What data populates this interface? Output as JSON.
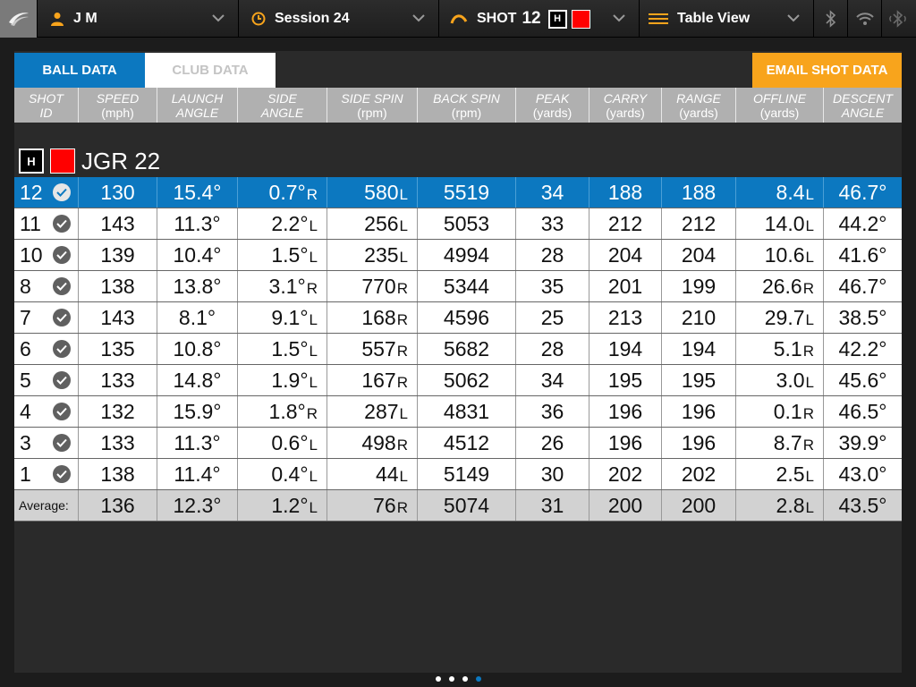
{
  "topbar": {
    "user": "J M",
    "session": "Session 24",
    "shot_label": "SHOT",
    "shot_number": "12",
    "shot_hand": "H",
    "view": "Table View"
  },
  "tabs": [
    {
      "label": "BALL DATA",
      "active": true
    },
    {
      "label": "CLUB DATA",
      "active": false
    }
  ],
  "email_button": "EMAIL SHOT DATA",
  "columns": [
    [
      "SHOT",
      "ID"
    ],
    [
      "SPEED",
      "(mph)"
    ],
    [
      "LAUNCH",
      "ANGLE"
    ],
    [
      "SIDE",
      "ANGLE"
    ],
    [
      "SIDE SPIN",
      "(rpm)"
    ],
    [
      "BACK SPIN",
      "(rpm)"
    ],
    [
      "PEAK",
      "(yards)"
    ],
    [
      "CARRY",
      "(yards)"
    ],
    [
      "RANGE",
      "(yards)"
    ],
    [
      "OFFLINE",
      "(yards)"
    ],
    [
      "DESCENT",
      "ANGLE"
    ]
  ],
  "club": {
    "hand": "H",
    "name": "JGR 22",
    "color": "#ff0000"
  },
  "rows": [
    {
      "id": "12",
      "selected": true,
      "speed": "130",
      "launch": "15.4°",
      "side": "0.7°",
      "side_dir": "R",
      "spin": "580",
      "spin_dir": "L",
      "back": "5519",
      "peak": "34",
      "carry": "188",
      "range": "188",
      "offline": "8.4",
      "off_dir": "L",
      "descent": "46.7°"
    },
    {
      "id": "11",
      "speed": "143",
      "launch": "11.3°",
      "side": "2.2°",
      "side_dir": "L",
      "spin": "256",
      "spin_dir": "L",
      "back": "5053",
      "peak": "33",
      "carry": "212",
      "range": "212",
      "offline": "14.0",
      "off_dir": "L",
      "descent": "44.2°"
    },
    {
      "id": "10",
      "speed": "139",
      "launch": "10.4°",
      "side": "1.5°",
      "side_dir": "L",
      "spin": "235",
      "spin_dir": "L",
      "back": "4994",
      "peak": "28",
      "carry": "204",
      "range": "204",
      "offline": "10.6",
      "off_dir": "L",
      "descent": "41.6°"
    },
    {
      "id": "8",
      "speed": "138",
      "launch": "13.8°",
      "side": "3.1°",
      "side_dir": "R",
      "spin": "770",
      "spin_dir": "R",
      "back": "5344",
      "peak": "35",
      "carry": "201",
      "range": "199",
      "offline": "26.6",
      "off_dir": "R",
      "descent": "46.7°"
    },
    {
      "id": "7",
      "speed": "143",
      "launch": "8.1°",
      "side": "9.1°",
      "side_dir": "L",
      "spin": "168",
      "spin_dir": "R",
      "back": "4596",
      "peak": "25",
      "carry": "213",
      "range": "210",
      "offline": "29.7",
      "off_dir": "L",
      "descent": "38.5°"
    },
    {
      "id": "6",
      "speed": "135",
      "launch": "10.8°",
      "side": "1.5°",
      "side_dir": "L",
      "spin": "557",
      "spin_dir": "R",
      "back": "5682",
      "peak": "28",
      "carry": "194",
      "range": "194",
      "offline": "5.1",
      "off_dir": "R",
      "descent": "42.2°"
    },
    {
      "id": "5",
      "speed": "133",
      "launch": "14.8°",
      "side": "1.9°",
      "side_dir": "L",
      "spin": "167",
      "spin_dir": "R",
      "back": "5062",
      "peak": "34",
      "carry": "195",
      "range": "195",
      "offline": "3.0",
      "off_dir": "L",
      "descent": "45.6°"
    },
    {
      "id": "4",
      "speed": "132",
      "launch": "15.9°",
      "side": "1.8°",
      "side_dir": "R",
      "spin": "287",
      "spin_dir": "L",
      "back": "4831",
      "peak": "36",
      "carry": "196",
      "range": "196",
      "offline": "0.1",
      "off_dir": "R",
      "descent": "46.5°"
    },
    {
      "id": "3",
      "speed": "133",
      "launch": "11.3°",
      "side": "0.6°",
      "side_dir": "L",
      "spin": "498",
      "spin_dir": "R",
      "back": "4512",
      "peak": "26",
      "carry": "196",
      "range": "196",
      "offline": "8.7",
      "off_dir": "R",
      "descent": "39.9°"
    },
    {
      "id": "1",
      "speed": "138",
      "launch": "11.4°",
      "side": "0.4°",
      "side_dir": "L",
      "spin": "44",
      "spin_dir": "L",
      "back": "5149",
      "peak": "30",
      "carry": "202",
      "range": "202",
      "offline": "2.5",
      "off_dir": "L",
      "descent": "43.0°"
    }
  ],
  "average": {
    "label": "Average:",
    "speed": "136",
    "launch": "12.3°",
    "side": "1.2°",
    "side_dir": "L",
    "spin": "76",
    "spin_dir": "R",
    "back": "5074",
    "peak": "31",
    "carry": "200",
    "range": "200",
    "offline": "2.8",
    "off_dir": "L",
    "descent": "43.5°"
  },
  "page_dots": {
    "count": 4,
    "active": 3
  },
  "colors": {
    "accent_blue": "#0c78c0",
    "accent_orange": "#f8a41c",
    "club_red": "#ff0000"
  }
}
